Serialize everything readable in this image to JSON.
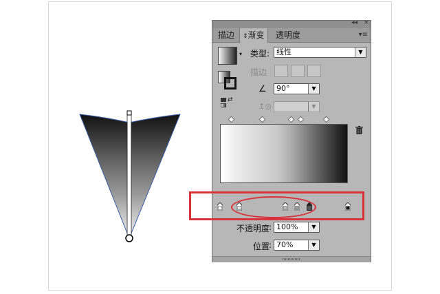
{
  "panel": {
    "tabs": [
      "描边",
      "渐变",
      "透明度"
    ],
    "active_tab": "渐变",
    "type_label": "类型:",
    "type_value": "线性",
    "stroke_label": "描边",
    "angle_value": "90°",
    "aspect_value": "",
    "opacity_label": "不透明度",
    "opacity_value": "100%",
    "location_label": "位置",
    "location_value": "70%"
  },
  "icons": {
    "gradient_preview": "gradient-swatch",
    "fill_stroke": "fill-stroke-icon",
    "reverse": "reverse-gradient-icon",
    "angle": "angle-icon",
    "aspect": "aspect-ratio-icon",
    "delete": "trash-icon",
    "panel_menu": "panel-menu-icon",
    "collapse": "collapse-icon"
  },
  "gradient": {
    "stops": [
      {
        "location": 0,
        "color": "#ffffff"
      },
      {
        "location": 15,
        "color": "#e9e9e9"
      },
      {
        "location": 51,
        "color": "#b8b8b8"
      },
      {
        "location": 60,
        "color": "#9a9a9a"
      },
      {
        "location": 70,
        "color": "#555555"
      },
      {
        "location": 100,
        "color": "#111111"
      }
    ],
    "selected_stop_location": 70
  },
  "colors": {
    "annotation": "#d9323a",
    "panel_bg": "#b7b7b7"
  }
}
